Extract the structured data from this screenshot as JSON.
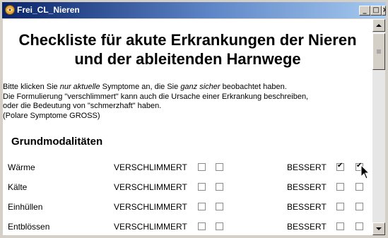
{
  "window": {
    "title": "Frei_CL_Nieren",
    "minimize_label": "_",
    "maximize_label": "□",
    "close_label": "×"
  },
  "page": {
    "heading_line1": "Checkliste für akute Erkrankungen der Nieren",
    "heading_line2": "und der ableitenden Harnwege",
    "intro": {
      "line1_a": "Bitte klicken Sie ",
      "line1_em1": "nur aktuelle",
      "line1_b": " Symptome an, die Sie ",
      "line1_em2": "ganz sicher",
      "line1_c": " beobachtet haben.",
      "line2": "Die Formulierung \"verschlimmert\" kann auch die Ursache einer Erkrankung beschreiben,",
      "line3": "oder die Bedeutung von \"schmerzhaft\" haben.",
      "line4": "(Polare Symptome GROSS)"
    },
    "section_title": "Grundmodalitäten",
    "worse_label": "VERSCHLIMMERT",
    "better_label": "BESSERT",
    "rows": [
      {
        "label": "Wärme",
        "worse": [
          false,
          false
        ],
        "better": [
          true,
          true
        ]
      },
      {
        "label": "Kälte",
        "worse": [
          false,
          false
        ],
        "better": [
          false,
          false
        ]
      },
      {
        "label": "Einhüllen",
        "worse": [
          false,
          false
        ],
        "better": [
          false,
          false
        ]
      },
      {
        "label": "Entblössen",
        "worse": [
          false,
          false
        ],
        "better": [
          false,
          false
        ]
      }
    ]
  }
}
